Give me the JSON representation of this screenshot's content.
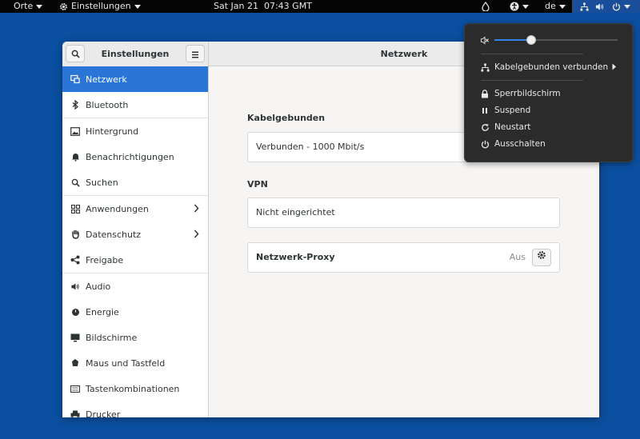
{
  "topbar": {
    "places": "Orte",
    "app_menu": "Einstellungen",
    "clock": "Sat Jan 21  07:43 GMT",
    "keyboard_layout": "de"
  },
  "window": {
    "sidebar_title": "Einstellungen",
    "title": "Netzwerk"
  },
  "sidebar": {
    "items": [
      {
        "label": "Netzwerk",
        "icon": "network-icon"
      },
      {
        "label": "Bluetooth",
        "icon": "bluetooth-icon"
      },
      {
        "label": "Hintergrund",
        "icon": "background-icon"
      },
      {
        "label": "Benachrichtigungen",
        "icon": "bell-icon"
      },
      {
        "label": "Suchen",
        "icon": "search-icon"
      },
      {
        "label": "Anwendungen",
        "icon": "apps-grid-icon"
      },
      {
        "label": "Datenschutz",
        "icon": "hand-icon"
      },
      {
        "label": "Freigabe",
        "icon": "share-icon"
      },
      {
        "label": "Audio",
        "icon": "speaker-icon"
      },
      {
        "label": "Energie",
        "icon": "power-icon"
      },
      {
        "label": "Bildschirme",
        "icon": "display-icon"
      },
      {
        "label": "Maus und Tastfeld",
        "icon": "mouse-icon"
      },
      {
        "label": "Tastenkombinationen",
        "icon": "keyboard-icon"
      },
      {
        "label": "Drucker",
        "icon": "printer-icon"
      }
    ]
  },
  "content": {
    "wired_title": "Kabelgebunden",
    "wired_status": "Verbunden - 1000 Mbit/s",
    "vpn_title": "VPN",
    "vpn_status": "Nicht eingerichtet",
    "proxy_label": "Netzwerk-Proxy",
    "proxy_status": "Aus"
  },
  "system_menu": {
    "volume_level": 0.3,
    "network": "Kabelgebunden verbunden",
    "lock": "Sperrbildschirm",
    "suspend": "Suspend",
    "restart": "Neustart",
    "power_off": "Ausschalten"
  },
  "colors": {
    "desktop": "#0b4fa0",
    "accent": "#2a76d6",
    "slider": "#3584e4"
  }
}
